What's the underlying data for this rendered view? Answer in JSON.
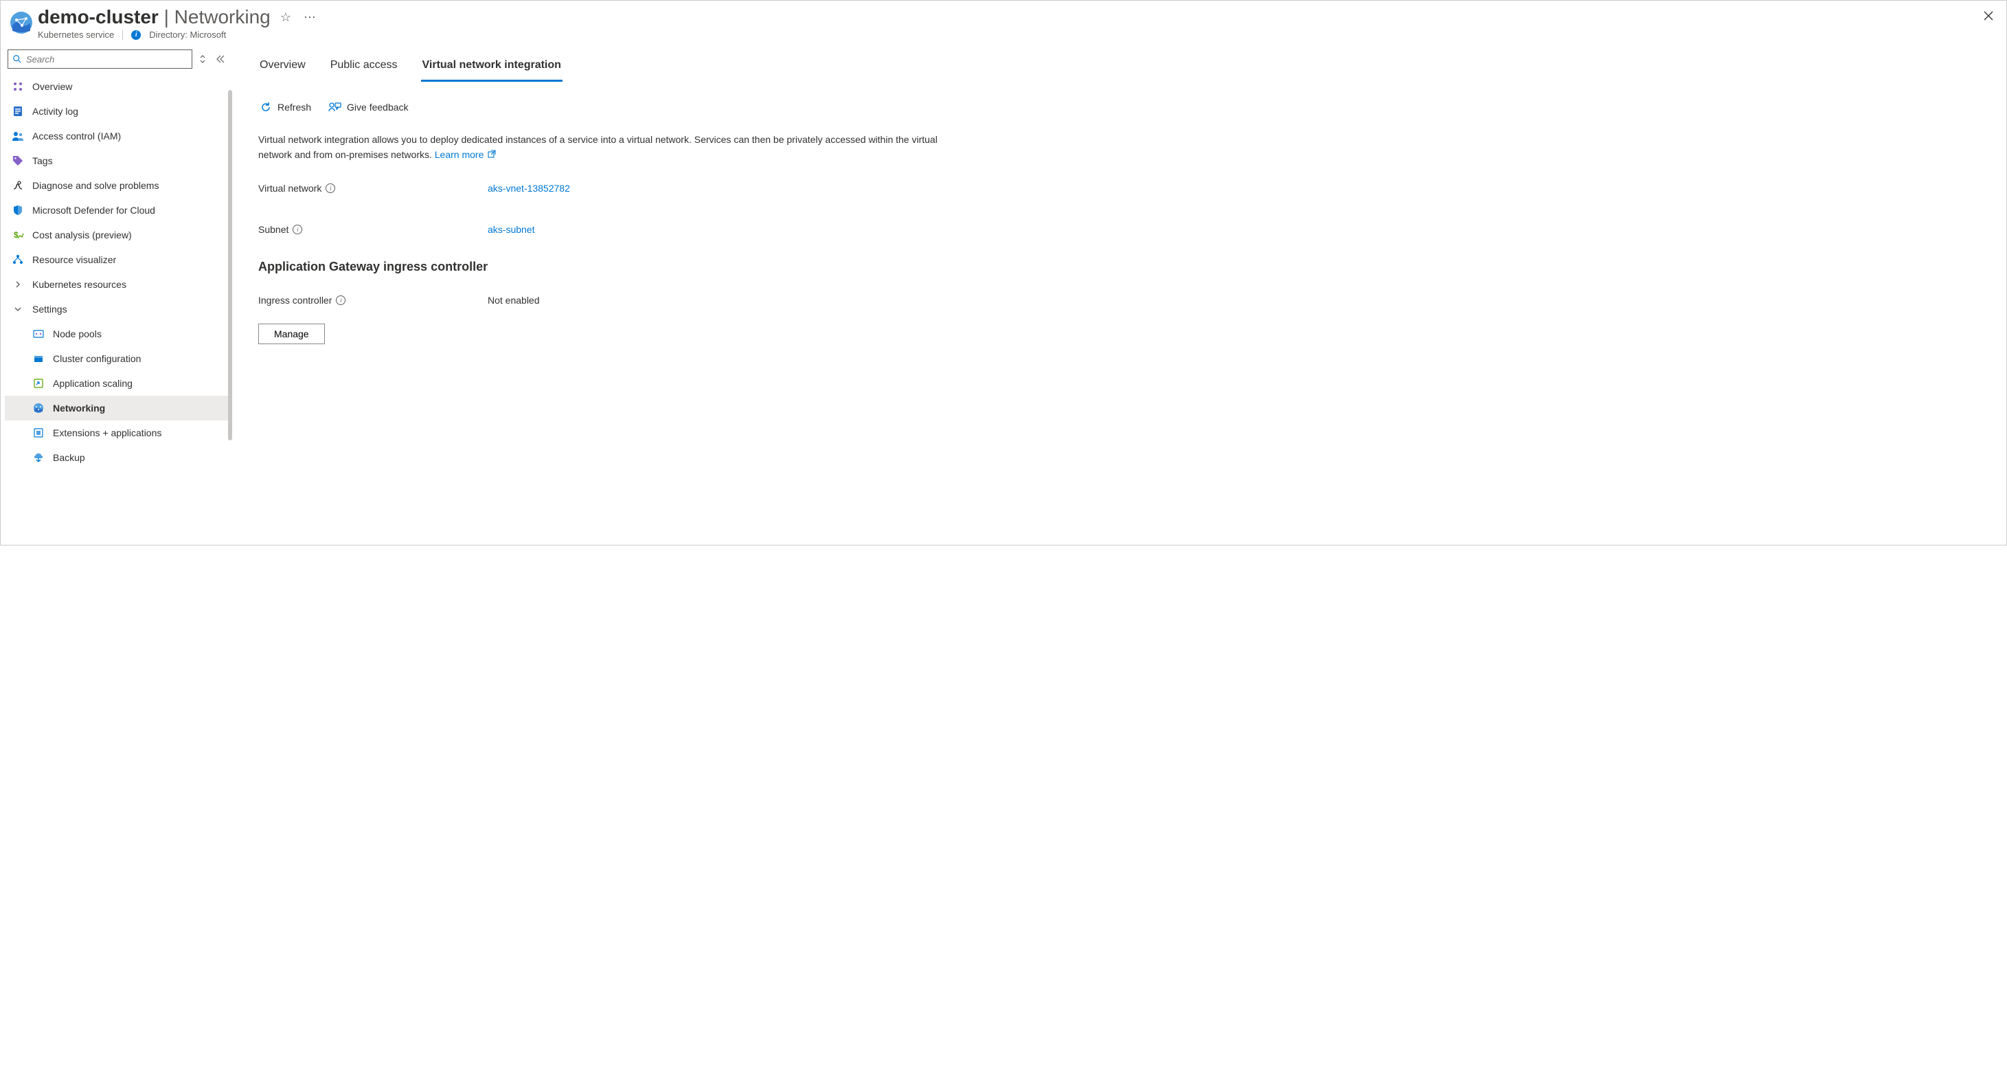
{
  "header": {
    "title_main": "demo-cluster",
    "title_separator": " | ",
    "title_sub": "Networking",
    "subtitle_service": "Kubernetes service",
    "subtitle_directory_label": "Directory: Microsoft"
  },
  "sidebar": {
    "search_placeholder": "Search",
    "items": [
      {
        "label": "Overview"
      },
      {
        "label": "Activity log"
      },
      {
        "label": "Access control (IAM)"
      },
      {
        "label": "Tags"
      },
      {
        "label": "Diagnose and solve problems"
      },
      {
        "label": "Microsoft Defender for Cloud"
      },
      {
        "label": "Cost analysis (preview)"
      },
      {
        "label": "Resource visualizer"
      },
      {
        "label": "Kubernetes resources"
      },
      {
        "label": "Settings"
      },
      {
        "label": "Node pools"
      },
      {
        "label": "Cluster configuration"
      },
      {
        "label": "Application scaling"
      },
      {
        "label": "Networking"
      },
      {
        "label": "Extensions + applications"
      },
      {
        "label": "Backup"
      }
    ]
  },
  "main": {
    "tabs": [
      {
        "label": "Overview"
      },
      {
        "label": "Public access"
      },
      {
        "label": "Virtual network integration"
      }
    ],
    "toolbar": {
      "refresh": "Refresh",
      "feedback": "Give feedback"
    },
    "description": "Virtual network integration allows you to deploy dedicated instances of a service into a virtual network. Services can then be privately accessed within the virtual network and from on-premises networks.",
    "learn_more": "Learn more",
    "kv": {
      "vnet_label": "Virtual network",
      "vnet_value": "aks-vnet-13852782",
      "subnet_label": "Subnet",
      "subnet_value": "aks-subnet"
    },
    "section_heading": "Application Gateway ingress controller",
    "ingress_label": "Ingress controller",
    "ingress_value": "Not enabled",
    "manage_btn": "Manage"
  }
}
